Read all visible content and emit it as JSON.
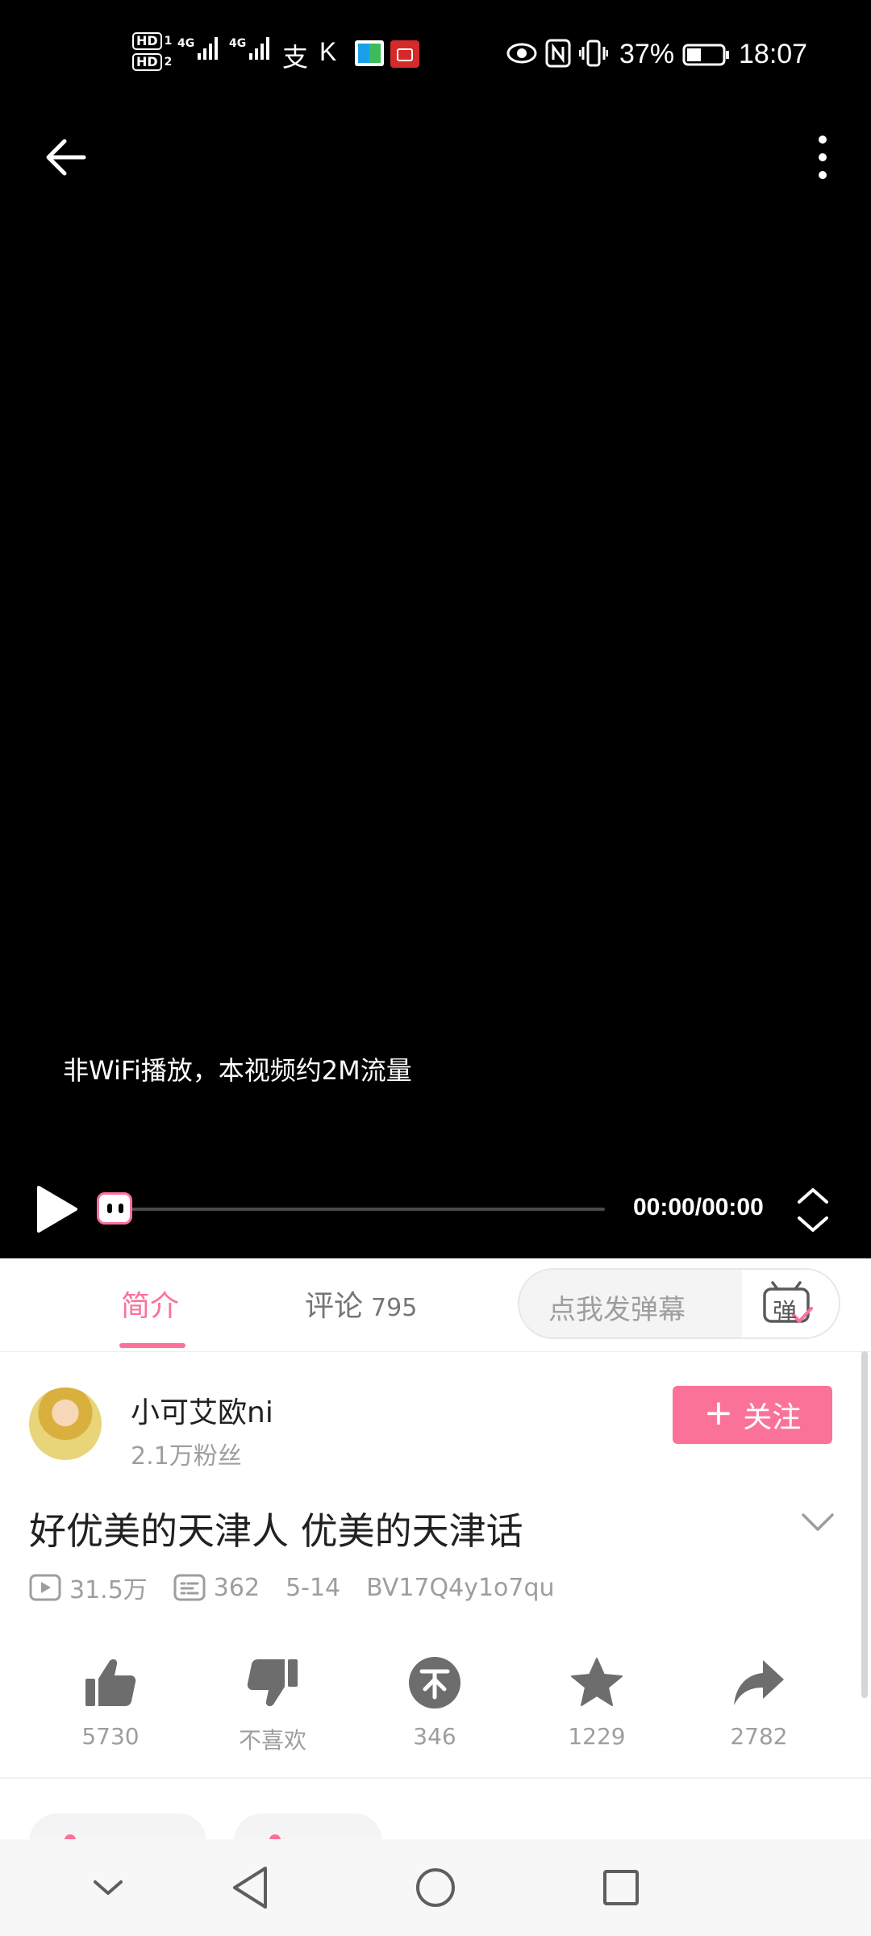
{
  "status_bar": {
    "hd1": "HD",
    "hd1_sub": "1",
    "hd2": "HD",
    "hd2_sub": "2",
    "net1": "4G",
    "net2": "4G",
    "app_glyph_1": "支",
    "app_glyph_2": "K",
    "battery_percent": "37%",
    "time": "18:07"
  },
  "player": {
    "traffic_hint": "非WiFi播放，本视频约2M流量",
    "time_display": "00:00/00:00",
    "progress": 0
  },
  "tabs": {
    "intro": "简介",
    "comments": "评论",
    "comments_count": "795",
    "danmaku_placeholder": "点我发弹幕",
    "danmaku_icon_glyph": "弹"
  },
  "uploader": {
    "name": "小可艾欧ni",
    "fans": "2.1万粉丝",
    "follow_label": "关注",
    "follow_plus": "+"
  },
  "video": {
    "title": "好优美的天津人 优美的天津话",
    "views": "31.5万",
    "danmaku_count": "362",
    "date": "5-14",
    "bvid": "BV17Q4y1o7qu"
  },
  "actions": {
    "like": "5730",
    "dislike": "不喜欢",
    "coin": "346",
    "favorite": "1229",
    "share": "2782"
  },
  "colors": {
    "accent": "#fb7299",
    "icon_gray": "#6d6d6d",
    "muted_text": "#9e9e9e"
  }
}
